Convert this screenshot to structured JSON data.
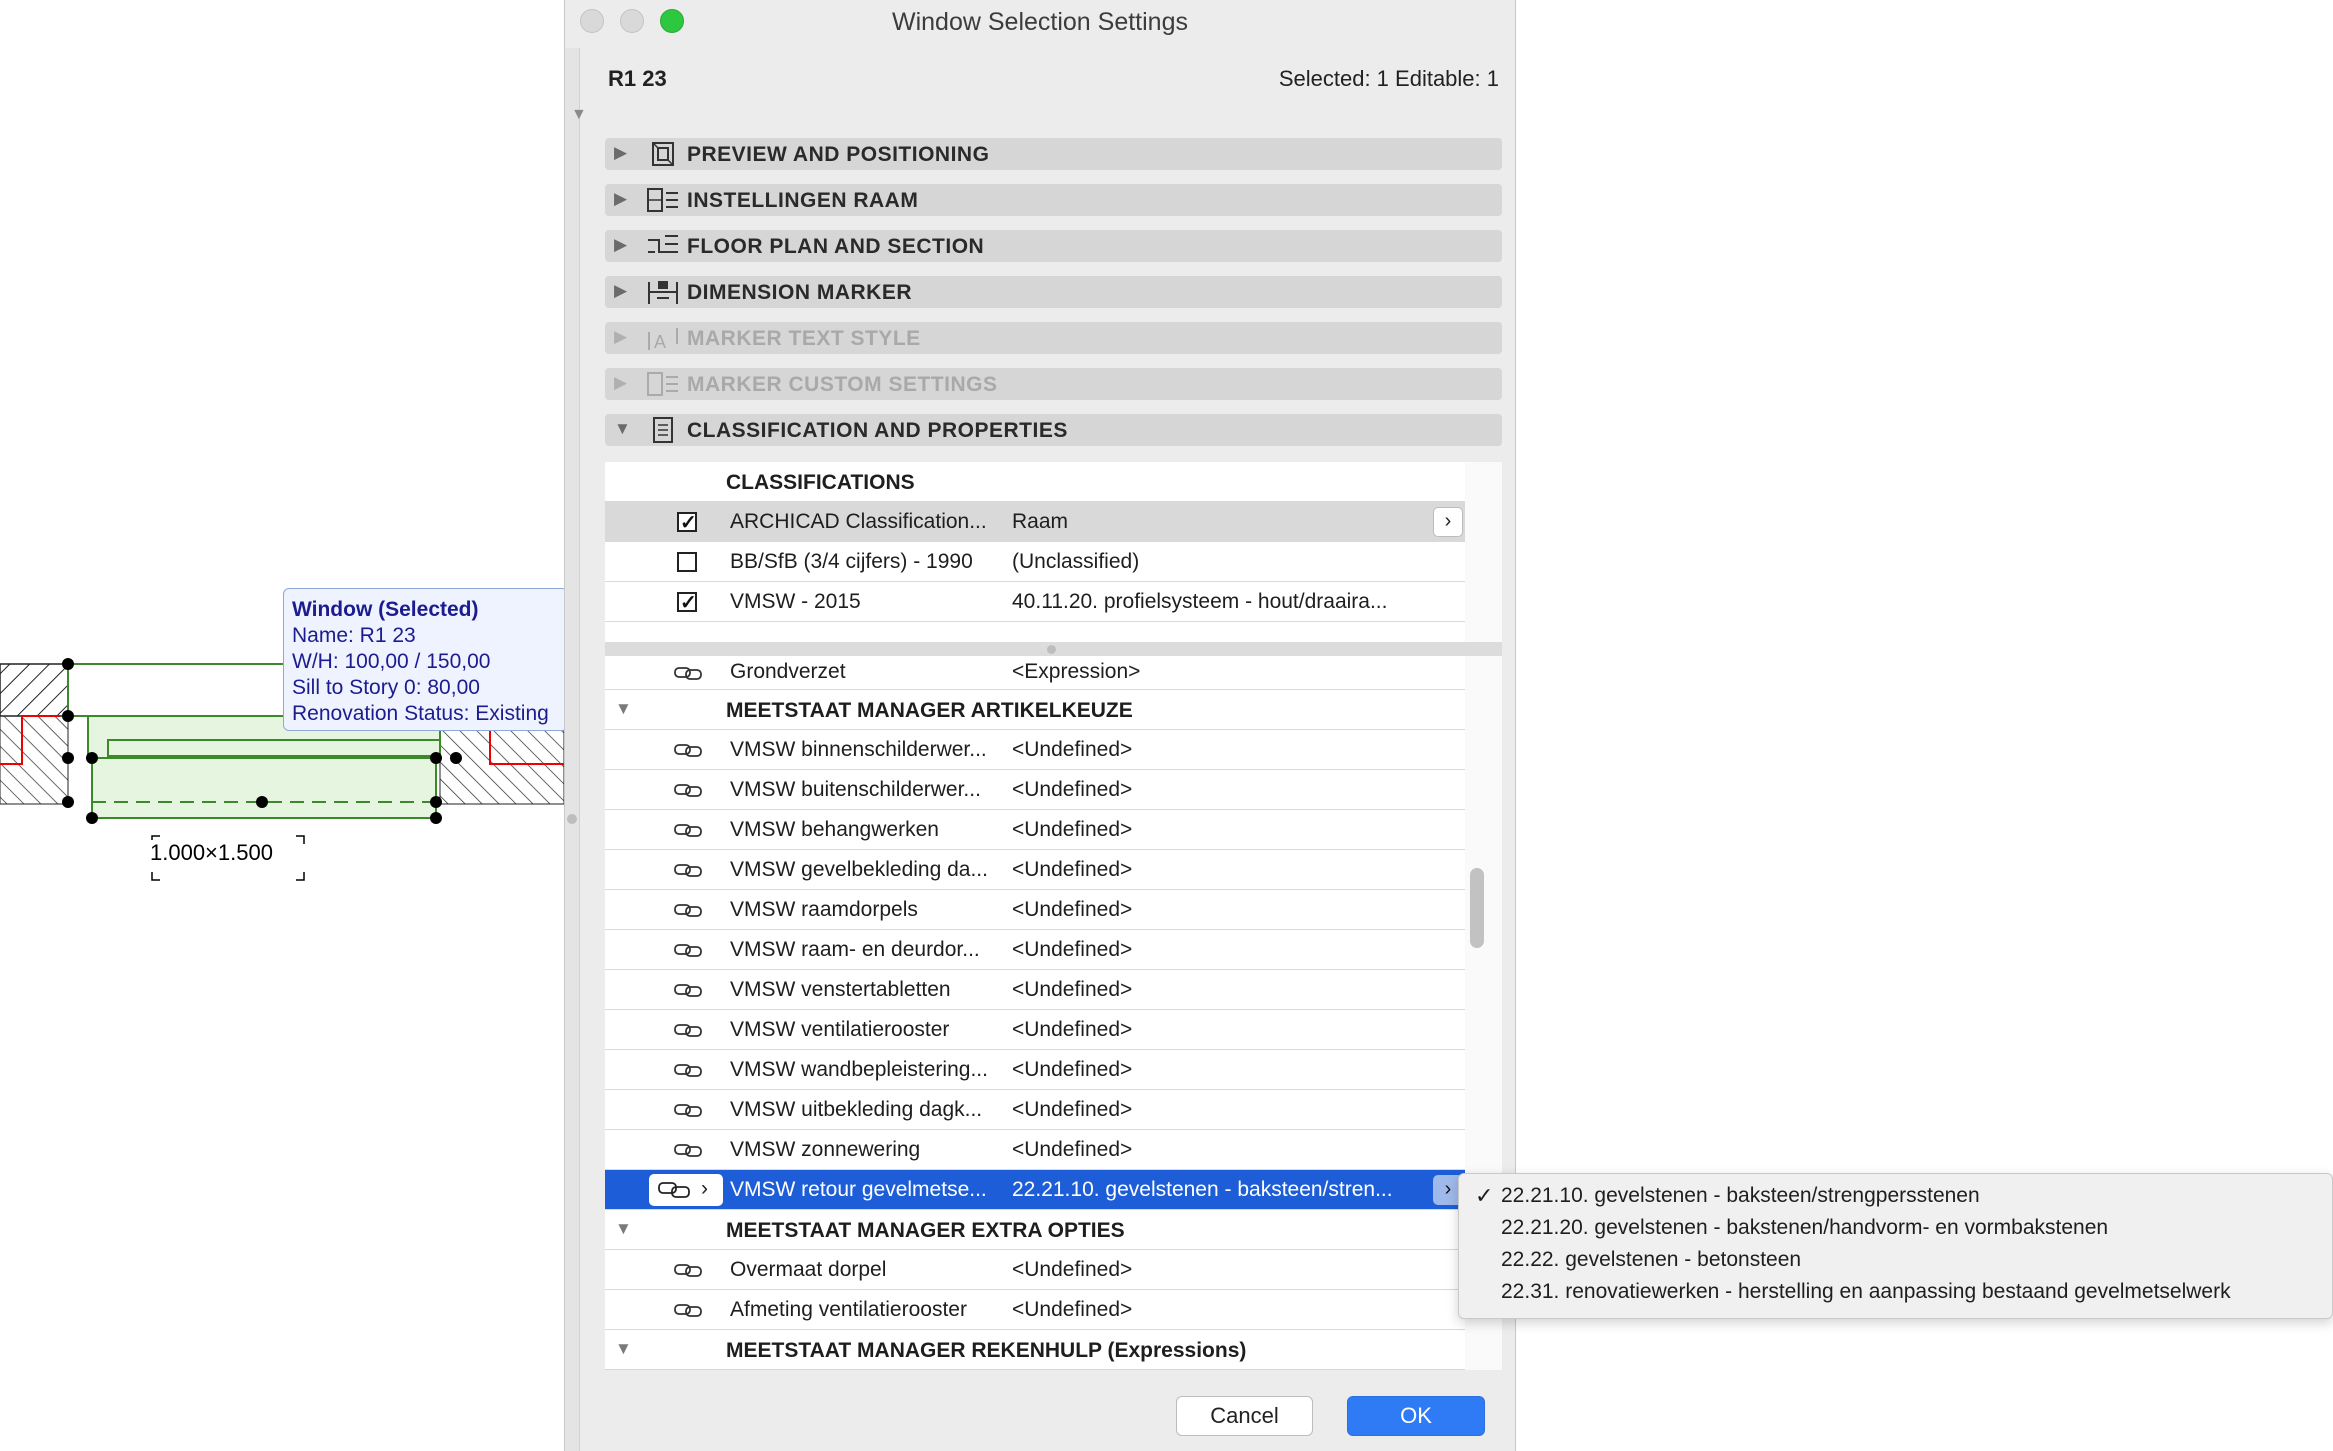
{
  "canvas": {
    "tooltip": {
      "title": "Window (Selected)",
      "name": "Name: R1 23",
      "wh": "W/H: 100,00 / 150,00",
      "sill": "Sill to Story 0: 80,00",
      "renovation": "Renovation Status: Existing"
    },
    "dimension_label": "1.000×1.500"
  },
  "dialog": {
    "title": "Window Selection Settings",
    "element_name": "R1 23",
    "selection_info": "Selected: 1 Editable: 1",
    "panels": [
      {
        "label": "PREVIEW AND POSITIONING",
        "icon": "preview-icon",
        "expanded": false,
        "enabled": true
      },
      {
        "label": "INSTELLINGEN RAAM",
        "icon": "window-settings-icon",
        "expanded": false,
        "enabled": true
      },
      {
        "label": "FLOOR PLAN AND SECTION",
        "icon": "floor-plan-icon",
        "expanded": false,
        "enabled": true
      },
      {
        "label": "DIMENSION MARKER",
        "icon": "dimension-marker-icon",
        "expanded": false,
        "enabled": true
      },
      {
        "label": "MARKER TEXT STYLE",
        "icon": "text-style-icon",
        "expanded": false,
        "enabled": false
      },
      {
        "label": "MARKER CUSTOM SETTINGS",
        "icon": "custom-settings-icon",
        "expanded": false,
        "enabled": false
      },
      {
        "label": "CLASSIFICATION AND PROPERTIES",
        "icon": "document-icon",
        "expanded": true,
        "enabled": true
      }
    ],
    "classifications": {
      "header": "CLASSIFICATIONS",
      "rows": [
        {
          "checked": true,
          "name": "ARCHICAD Classification...",
          "value": "Raam"
        },
        {
          "checked": false,
          "name": "BB/SfB (3/4 cijfers) - 1990",
          "value": "(Unclassified)"
        },
        {
          "checked": true,
          "name": "VMSW - 2015",
          "value": "40.11.20. profielsysteem - hout/draaira..."
        }
      ]
    },
    "properties": {
      "top_row": {
        "name": "Grondverzet",
        "value": "<Expression>"
      },
      "group1": {
        "label": "MEETSTAAT MANAGER ARTIKELKEUZE",
        "rows": [
          {
            "name": "VMSW binnenschilderwer...",
            "value": "<Undefined>"
          },
          {
            "name": "VMSW buitenschilderwer...",
            "value": "<Undefined>"
          },
          {
            "name": "VMSW behangwerken",
            "value": "<Undefined>"
          },
          {
            "name": "VMSW gevelbekleding da...",
            "value": "<Undefined>"
          },
          {
            "name": "VMSW raamdorpels",
            "value": "<Undefined>"
          },
          {
            "name": "VMSW raam- en deurdor...",
            "value": "<Undefined>"
          },
          {
            "name": "VMSW venstertabletten",
            "value": "<Undefined>"
          },
          {
            "name": "VMSW ventilatierooster",
            "value": "<Undefined>"
          },
          {
            "name": "VMSW wandbepleistering...",
            "value": "<Undefined>"
          },
          {
            "name": "VMSW uitbekleding dagk...",
            "value": "<Undefined>"
          },
          {
            "name": "VMSW zonnewering",
            "value": "<Undefined>"
          }
        ],
        "selected_row": {
          "name": "VMSW retour gevelmetse...",
          "value": "22.21.10. gevelstenen - baksteen/stren..."
        }
      },
      "group2": {
        "label": "MEETSTAAT MANAGER EXTRA OPTIES",
        "rows": [
          {
            "name": "Overmaat dorpel",
            "value": "<Undefined>"
          },
          {
            "name": "Afmeting ventilatierooster",
            "value": "<Undefined>"
          }
        ]
      },
      "group3": {
        "label": "MEETSTAAT MANAGER REKENHULP (Expressions)"
      }
    },
    "buttons": {
      "cancel": "Cancel",
      "ok": "OK"
    }
  },
  "popup_menu": {
    "items": [
      {
        "label": "22.21.10. gevelstenen - baksteen/strengpersstenen",
        "checked": true
      },
      {
        "label": "22.21.20. gevelstenen - bakstenen/handvorm- en vormbakstenen",
        "checked": false
      },
      {
        "label": "22.22. gevelstenen - betonsteen",
        "checked": false
      },
      {
        "label": "22.31. renovatiewerken - herstelling en aanpassing bestaand gevelmetselwerk",
        "checked": false
      }
    ],
    "check_glyph": "✓"
  },
  "colors": {
    "selection_blue": "#1d5ed8",
    "ok_button": "#2f7bf5",
    "tooltip_text": "#1c1c8e",
    "window_fill": "#e6f5e0",
    "window_stroke": "#3a8a2a"
  }
}
